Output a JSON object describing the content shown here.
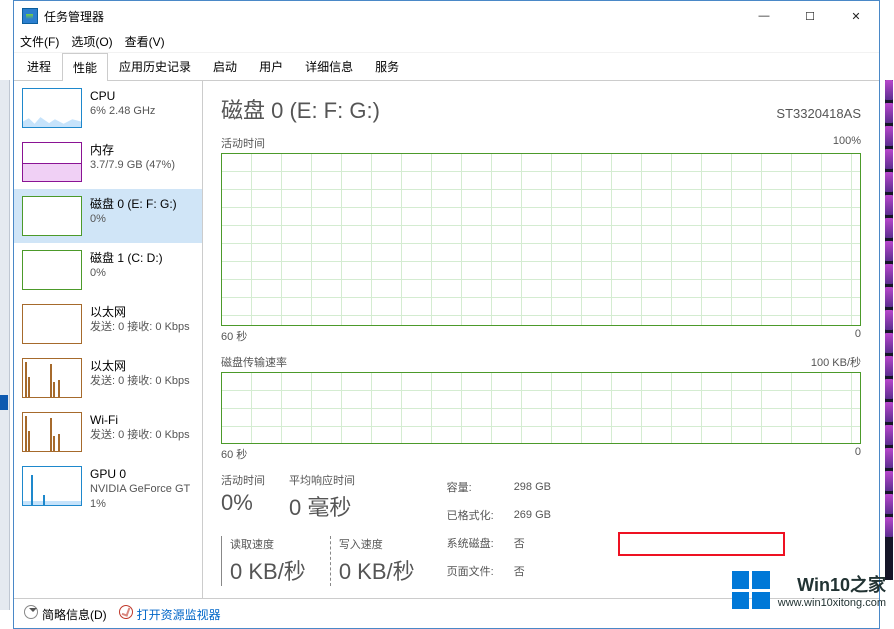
{
  "window": {
    "title": "任务管理器"
  },
  "menu": {
    "file": "文件(F)",
    "options": "选项(O)",
    "view": "查看(V)"
  },
  "tabs": [
    "进程",
    "性能",
    "应用历史记录",
    "启动",
    "用户",
    "详细信息",
    "服务"
  ],
  "sidebar": [
    {
      "title": "CPU",
      "sub": "6% 2.48 GHz"
    },
    {
      "title": "内存",
      "sub": "3.7/7.9 GB (47%)"
    },
    {
      "title": "磁盘 0 (E: F: G:)",
      "sub": "0%"
    },
    {
      "title": "磁盘 1 (C: D:)",
      "sub": "0%"
    },
    {
      "title": "以太网",
      "sub": "发送: 0 接收: 0 Kbps"
    },
    {
      "title": "以太网",
      "sub": "发送: 0 接收: 0 Kbps"
    },
    {
      "title": "Wi-Fi",
      "sub": "发送: 0 接收: 0 Kbps"
    },
    {
      "title": "GPU 0",
      "sub": "NVIDIA GeForce GT",
      "sub2": "1%"
    }
  ],
  "main": {
    "title": "磁盘 0 (E: F: G:)",
    "model": "ST3320418AS",
    "graph1": {
      "label": "活动时间",
      "max": "100%",
      "xleft": "60 秒",
      "xright": "0"
    },
    "graph2": {
      "label": "磁盘传输速率",
      "max": "100 KB/秒",
      "xleft": "60 秒",
      "xright": "0"
    },
    "stats": {
      "active_label": "活动时间",
      "active_val": "0%",
      "resp_label": "平均响应时间",
      "resp_val": "0 毫秒",
      "read_label": "读取速度",
      "read_val": "0 KB/秒",
      "write_label": "写入速度",
      "write_val": "0 KB/秒"
    },
    "info": {
      "capacity_l": "容量:",
      "capacity_v": "298 GB",
      "formatted_l": "已格式化:",
      "formatted_v": "269 GB",
      "sysdisk_l": "系统磁盘:",
      "sysdisk_v": "否",
      "pagefile_l": "页面文件:",
      "pagefile_v": "否"
    }
  },
  "footer": {
    "brief": "简略信息(D)",
    "resmon": "打开资源监视器"
  },
  "watermark": {
    "title": "Win10之家",
    "url": "www.win10xitong.com"
  },
  "chart_data": [
    {
      "type": "line",
      "title": "活动时间",
      "ylim": [
        0,
        100
      ],
      "xlim": [
        60,
        0
      ],
      "xlabel": "60 秒",
      "ylabel": "%",
      "series": [
        {
          "name": "活动时间",
          "values": [
            0,
            0,
            0,
            0,
            0,
            0,
            0,
            0,
            0,
            0,
            0,
            0,
            0,
            0,
            0,
            0,
            0,
            0,
            0,
            0
          ]
        }
      ]
    },
    {
      "type": "line",
      "title": "磁盘传输速率",
      "ylim": [
        0,
        100
      ],
      "xlim": [
        60,
        0
      ],
      "xlabel": "60 秒",
      "ylabel": "KB/秒",
      "series": [
        {
          "name": "传输速率",
          "values": [
            0,
            0,
            0,
            0,
            0,
            0,
            0,
            0,
            0,
            0,
            0,
            0,
            0,
            0,
            0,
            0,
            0,
            0,
            0,
            0
          ]
        }
      ]
    }
  ]
}
